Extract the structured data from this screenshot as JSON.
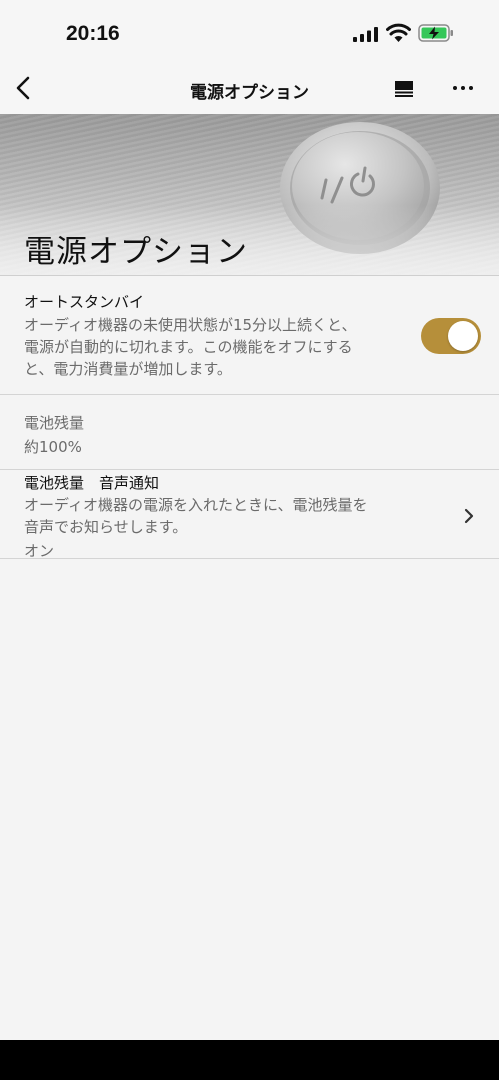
{
  "status_bar": {
    "time": "20:16"
  },
  "nav": {
    "title": "電源オプション"
  },
  "hero": {
    "title": "電源オプション"
  },
  "auto_standby": {
    "title": "オートスタンバイ",
    "description_lines": [
      "オーディオ機器の未使用状態が15分以上続くと、",
      "電源が自動的に切れます。この機能をオフにする",
      "と、電力消費量が増加します。"
    ],
    "enabled": true,
    "toggle_color": "#b68f3a"
  },
  "battery_level": {
    "label": "電池残量",
    "value": "約100%"
  },
  "battery_voice": {
    "title": "電池残量　音声通知",
    "description_lines": [
      "オーディオ機器の電源を入れたときに、電池残量を",
      "音声でお知らせします。"
    ],
    "value": "オン"
  },
  "icons": [
    "signal-icon",
    "wifi-icon",
    "battery-charging-icon",
    "back-chevron-icon",
    "queue-icon",
    "more-icon",
    "power-symbol-icon",
    "chevron-right-icon"
  ]
}
